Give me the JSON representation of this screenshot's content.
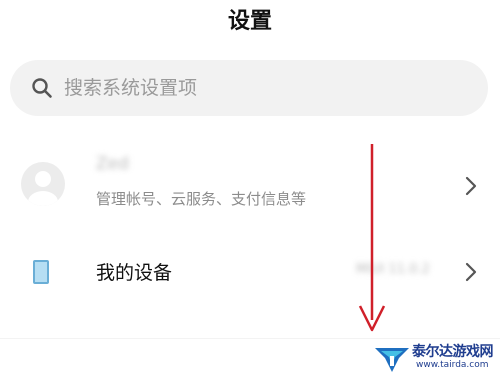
{
  "header": {
    "title": "设置"
  },
  "search": {
    "placeholder": "搜索系统设置项",
    "icon": "search-icon"
  },
  "account": {
    "name": "Zed",
    "subtitle": "管理帐号、云服务、支付信息等",
    "icon": "avatar-icon"
  },
  "device": {
    "label": "我的设备",
    "value": "MIUI 11.0.2",
    "icon": "device-icon"
  },
  "watermark": {
    "name": "泰尔达游戏网",
    "url": "www.tairda.com"
  },
  "colors": {
    "arrow": "#d0202a",
    "accent": "#1f3d8f",
    "device_icon_fill": "#b6def3",
    "search_background": "#f2f2f2"
  }
}
